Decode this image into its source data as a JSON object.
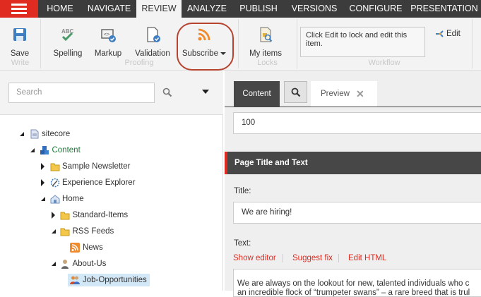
{
  "nav": {
    "tabs": [
      "HOME",
      "NAVIGATE",
      "REVIEW",
      "ANALYZE",
      "PUBLISH",
      "VERSIONS",
      "CONFIGURE",
      "PRESENTATION"
    ],
    "active": "REVIEW"
  },
  "ribbon": {
    "buttons": {
      "save": "Save",
      "spelling": "Spelling",
      "markup": "Markup",
      "validation": "Validation",
      "subscribe": "Subscribe",
      "my_items": "My items",
      "edit": "Edit"
    },
    "groups": {
      "write": "Write",
      "proofing": "Proofing",
      "locks": "Locks",
      "workflow": "Workflow"
    },
    "workflow_message": "Click Edit to lock and edit this item.",
    "highlight_color": "#b5432f"
  },
  "search": {
    "placeholder": "Search"
  },
  "tree": [
    {
      "label": "sitecore",
      "level": 0,
      "state": "open",
      "icon": "document-icon"
    },
    {
      "label": "Content",
      "level": 1,
      "state": "open",
      "icon": "cubes-icon"
    },
    {
      "label": "Sample Newsletter",
      "level": 2,
      "state": "closed",
      "icon": "folder-icon"
    },
    {
      "label": "Experience Explorer",
      "level": 2,
      "state": "closed",
      "icon": "explorer-icon"
    },
    {
      "label": "Home",
      "level": 2,
      "state": "open",
      "icon": "home-icon"
    },
    {
      "label": "Standard-Items",
      "level": 3,
      "state": "closed",
      "icon": "folder-icon"
    },
    {
      "label": "RSS Feeds",
      "level": 3,
      "state": "open",
      "icon": "folder-icon"
    },
    {
      "label": "News",
      "level": 4,
      "state": "leaf",
      "icon": "rss-icon"
    },
    {
      "label": "About-Us",
      "level": 3,
      "state": "open",
      "icon": "person-icon"
    },
    {
      "label": "Job-Opportunities",
      "level": 4,
      "state": "leaf",
      "icon": "people-icon",
      "selected": true
    }
  ],
  "editor": {
    "tabs": {
      "content": "Content",
      "preview": "Preview"
    },
    "field_value": "100",
    "section_title": "Page Title and Text",
    "title_label": "Title:",
    "title_value": "We are hiring!",
    "text_label": "Text:",
    "links": {
      "show_editor": "Show editor",
      "suggest_fix": "Suggest fix",
      "edit_html": "Edit HTML"
    },
    "text_value": "We are always on the lookout for new, talented individuals who c",
    "text_value_line2": "an incredible flock of “trumpeter swans” – a rare breed that is trul"
  }
}
